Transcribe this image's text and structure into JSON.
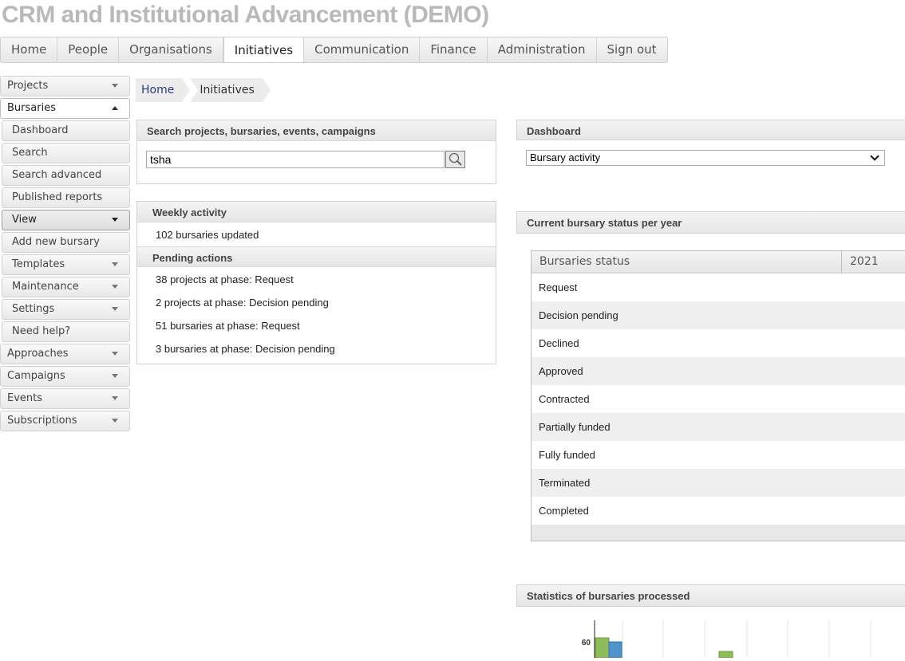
{
  "app": {
    "title": "CRM and Institutional Advancement (DEMO)"
  },
  "topnav": [
    {
      "label": "Home"
    },
    {
      "label": "People"
    },
    {
      "label": "Organisations"
    },
    {
      "label": "Initiatives",
      "active": true
    },
    {
      "label": "Communication"
    },
    {
      "label": "Finance"
    },
    {
      "label": "Administration"
    },
    {
      "label": "Sign out"
    }
  ],
  "sidebar": {
    "projects": "Projects",
    "bursaries": "Bursaries",
    "sub": {
      "dashboard": "Dashboard",
      "search": "Search",
      "search_advanced": "Search advanced",
      "published_reports": "Published reports",
      "view": "View",
      "add_new": "Add new bursary",
      "templates": "Templates",
      "maintenance": "Maintenance",
      "settings": "Settings",
      "need_help": "Need help?"
    },
    "approaches": "Approaches",
    "campaigns": "Campaigns",
    "events": "Events",
    "subscriptions": "Subscriptions"
  },
  "breadcrumb": {
    "home": "Home",
    "current": "Initiatives"
  },
  "search": {
    "heading": "Search projects, bursaries, events, campaigns",
    "value": "tsha"
  },
  "weekly": {
    "heading": "Weekly activity",
    "updated": "102 bursaries updated",
    "pending_heading": "Pending actions",
    "pending": [
      "38 projects at phase: Request",
      "2 projects at phase: Decision pending",
      "51 bursaries at phase: Request",
      "3 bursaries at phase: Decision pending"
    ]
  },
  "dashboard": {
    "heading": "Dashboard",
    "selected": "Bursary activity"
  },
  "status": {
    "heading": "Current bursary status per year",
    "col_status": "Bursaries status",
    "col_year": "2021",
    "rows": [
      "Request",
      "Decision pending",
      "Declined",
      "Approved",
      "Contracted",
      "Partially funded",
      "Fully funded",
      "Terminated",
      "Completed"
    ]
  },
  "stats": {
    "heading": "Statistics of bursaries processed"
  },
  "chart_data": {
    "type": "bar",
    "yticks": [
      "60"
    ],
    "colors": {
      "green": "#8fbc5a",
      "blue": "#4f93c9"
    }
  }
}
